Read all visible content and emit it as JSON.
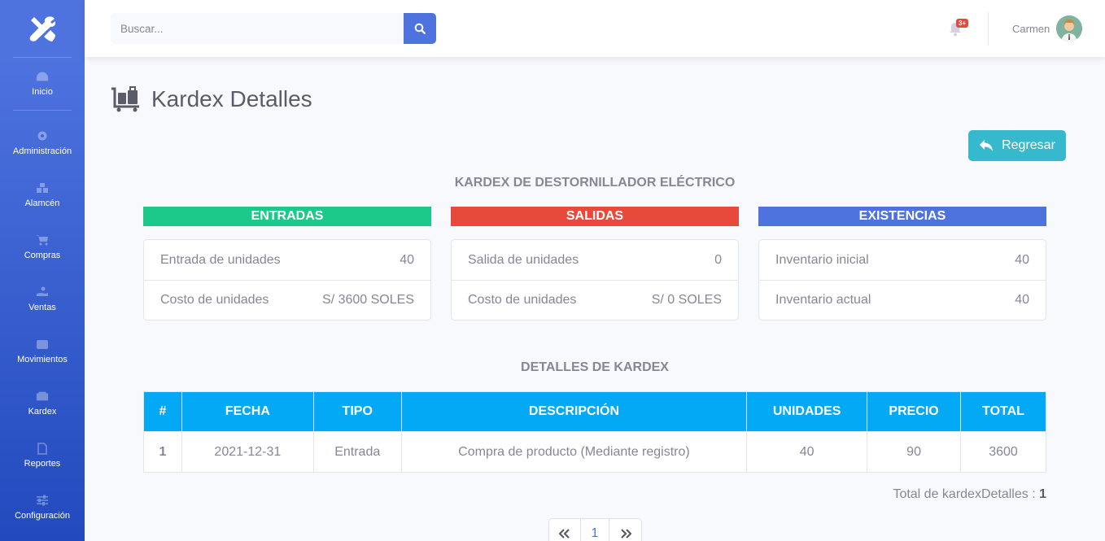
{
  "sidebar": {
    "brand_icon": "tools-icon",
    "items": [
      {
        "label": "Inicio",
        "icon": "tachometer-icon"
      },
      {
        "label": "Administración",
        "icon": "gear-icon"
      },
      {
        "label": "Alamcén",
        "icon": "boxes-icon"
      },
      {
        "label": "Compras",
        "icon": "cart-icon"
      },
      {
        "label": "Ventas",
        "icon": "hand-coins-icon"
      },
      {
        "label": "Movimientos",
        "icon": "wallet-icon"
      },
      {
        "label": "Kardex",
        "icon": "box-icon"
      },
      {
        "label": "Reportes",
        "icon": "file-icon"
      },
      {
        "label": "Configuración",
        "icon": "sliders-icon"
      }
    ]
  },
  "topbar": {
    "search_placeholder": "Buscar...",
    "notifications_badge": "3+",
    "user_name": "Carmen"
  },
  "page": {
    "title": "Kardex Detalles",
    "back_label": "Regresar",
    "kardex_title": "KARDEX DE DESTORNILLADOR ELÉCTRICO",
    "details_title": "DETALLES DE KARDEX"
  },
  "cards": {
    "entradas": {
      "header": "ENTRADAS",
      "color": "#1cc88a",
      "rows": [
        {
          "label": "Entrada de unidades",
          "value": "40"
        },
        {
          "label": "Costo de unidades",
          "value": "S/ 3600 SOLES"
        }
      ]
    },
    "salidas": {
      "header": "SALIDAS",
      "color": "#e74a3b",
      "rows": [
        {
          "label": "Salida de unidades",
          "value": "0"
        },
        {
          "label": "Costo de unidades",
          "value": "S/ 0 SOLES"
        }
      ]
    },
    "existencias": {
      "header": "EXISTENCIAS",
      "color": "#4e73df",
      "rows": [
        {
          "label": "Inventario inicial",
          "value": "40"
        },
        {
          "label": "Inventario actual",
          "value": "40"
        }
      ]
    }
  },
  "table": {
    "headers": [
      "#",
      "FECHA",
      "TIPO",
      "DESCRIPCIÓN",
      "UNIDADES",
      "PRECIO",
      "TOTAL"
    ],
    "rows": [
      [
        "1",
        "2021-12-31",
        "Entrada",
        "Compra de producto (Mediante registro)",
        "40",
        "90",
        "3600"
      ]
    ]
  },
  "footer": {
    "total_label": "Total de kardexDetalles :",
    "total_value": "1",
    "current_page": "1"
  }
}
